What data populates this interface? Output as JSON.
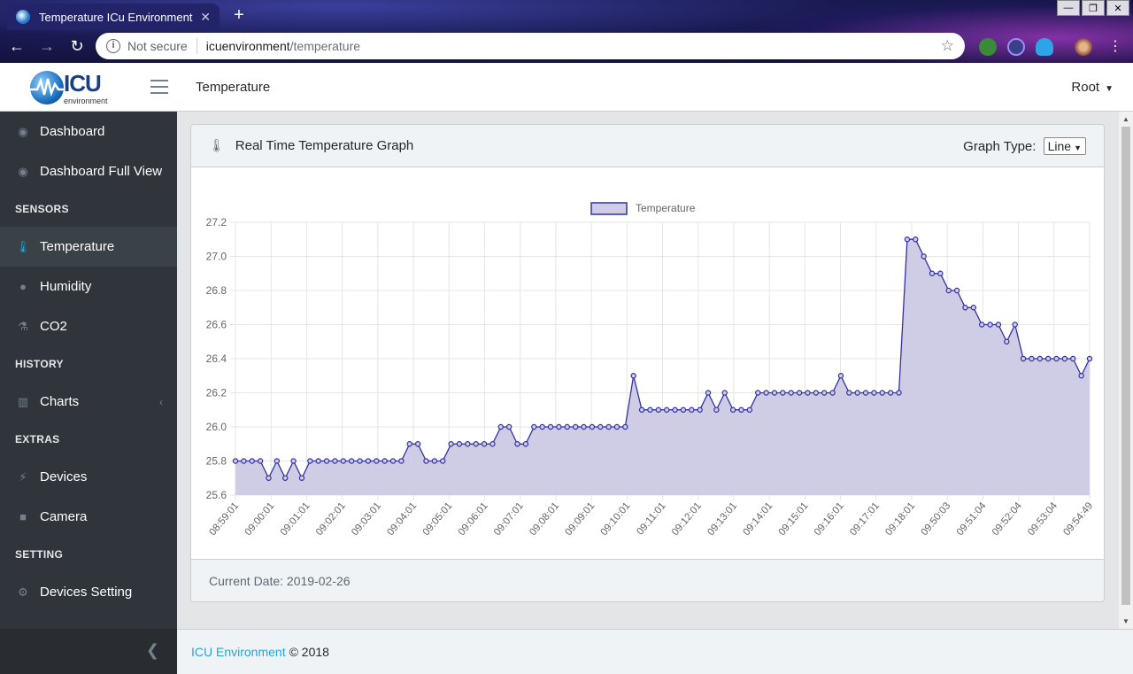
{
  "browser": {
    "tab_title": "Temperature ICu Environment",
    "security_label": "Not secure",
    "url_host": "icuenvironment",
    "url_path": "/temperature"
  },
  "header": {
    "logo_text": "ICU",
    "logo_subtext": "environment",
    "page_title": "Temperature",
    "user_label": "Root"
  },
  "sidebar": {
    "items": [
      {
        "type": "item",
        "label": "Dashboard",
        "icon": "dashboard-icon"
      },
      {
        "type": "item",
        "label": "Dashboard Full View",
        "icon": "dashboard-icon"
      },
      {
        "type": "title",
        "label": "SENSORS"
      },
      {
        "type": "item",
        "label": "Temperature",
        "icon": "thermometer-icon",
        "active": true
      },
      {
        "type": "item",
        "label": "Humidity",
        "icon": "droplet-icon"
      },
      {
        "type": "item",
        "label": "CO2",
        "icon": "flask-icon"
      },
      {
        "type": "title",
        "label": "HISTORY"
      },
      {
        "type": "item",
        "label": "Charts",
        "icon": "bar-chart-icon",
        "chevron": true
      },
      {
        "type": "title",
        "label": "EXTRAS"
      },
      {
        "type": "item",
        "label": "Devices",
        "icon": "plug-icon"
      },
      {
        "type": "item",
        "label": "Camera",
        "icon": "camera-icon"
      },
      {
        "type": "title",
        "label": "SETTING"
      },
      {
        "type": "item",
        "label": "Devices Setting",
        "icon": "gear-icon"
      }
    ]
  },
  "card": {
    "title": "Real Time Temperature Graph",
    "graph_type_label": "Graph Type:",
    "graph_type_value": "Line",
    "current_date": "Current Date: 2019-02-26"
  },
  "footer": {
    "link_text": "ICU Environment",
    "copyright": "© 2018"
  },
  "chart_data": {
    "type": "area",
    "legend": [
      "Temperature"
    ],
    "legend_position": "top",
    "grid": true,
    "ylim": [
      25.6,
      27.2
    ],
    "y_ticks": [
      25.6,
      25.8,
      26.0,
      26.2,
      26.4,
      26.6,
      26.8,
      27.0,
      27.2
    ],
    "x_tick_labels": [
      "08:59:01",
      "09:00:01",
      "09:01:01",
      "09:02:01",
      "09:03:01",
      "09:04:01",
      "09:05:01",
      "09:06:01",
      "09:07:01",
      "09:08:01",
      "09:09:01",
      "09:10:01",
      "09:11:01",
      "09:12:01",
      "09:13:01",
      "09:14:01",
      "09:15:01",
      "09:16:01",
      "09:17:01",
      "09:18:01",
      "09:50:03",
      "09:51:04",
      "09:52:04",
      "09:53:04",
      "09:54:49"
    ],
    "series": [
      {
        "name": "Temperature",
        "values": [
          25.8,
          25.8,
          25.8,
          25.8,
          25.7,
          25.8,
          25.7,
          25.8,
          25.7,
          25.8,
          25.8,
          25.8,
          25.8,
          25.8,
          25.8,
          25.8,
          25.8,
          25.8,
          25.8,
          25.8,
          25.8,
          25.9,
          25.9,
          25.8,
          25.8,
          25.8,
          25.9,
          25.9,
          25.9,
          25.9,
          25.9,
          25.9,
          26.0,
          26.0,
          25.9,
          25.9,
          26.0,
          26.0,
          26.0,
          26.0,
          26.0,
          26.0,
          26.0,
          26.0,
          26.0,
          26.0,
          26.0,
          26.0,
          26.3,
          26.1,
          26.1,
          26.1,
          26.1,
          26.1,
          26.1,
          26.1,
          26.1,
          26.2,
          26.1,
          26.2,
          26.1,
          26.1,
          26.1,
          26.2,
          26.2,
          26.2,
          26.2,
          26.2,
          26.2,
          26.2,
          26.2,
          26.2,
          26.2,
          26.3,
          26.2,
          26.2,
          26.2,
          26.2,
          26.2,
          26.2,
          26.2,
          27.1,
          27.1,
          27.0,
          26.9,
          26.9,
          26.8,
          26.8,
          26.7,
          26.7,
          26.6,
          26.6,
          26.6,
          26.5,
          26.6,
          26.4,
          26.4,
          26.4,
          26.4,
          26.4,
          26.4,
          26.4,
          26.3,
          26.4
        ]
      }
    ],
    "colors": {
      "line": "#3232a0",
      "fill": "#cfcce6",
      "point_fill": "#cfcce6"
    }
  }
}
